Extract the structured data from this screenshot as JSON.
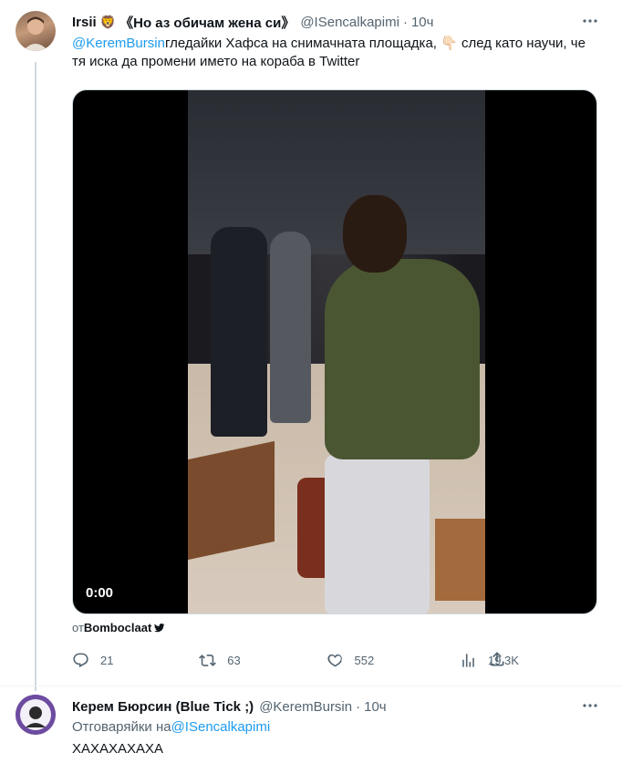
{
  "main_tweet": {
    "display_name": "Irsii",
    "name_suffix": "《Но аз обичам жена си》",
    "handle": "@ISencalkapimi",
    "time": "10ч",
    "mention": "@KeremBursin",
    "text_part1": "гледайки Хафса на снимачната площадка, ",
    "text_part2": " след като научи, че тя иска да промени името на кораба в Twitter",
    "emoji_lion": "🦁",
    "emoji_hand": "👇🏻",
    "video_time": "0:00",
    "attribution_prefix": "от",
    "attribution_source": "Bomboclaat",
    "stats": {
      "replies": "21",
      "retweets": "63",
      "likes": "552",
      "views": "19.3K"
    }
  },
  "reply_tweet": {
    "display_name": "Керем Бюрсин (Blue Tick ;)",
    "handle": "@KeremBursin",
    "time": "10ч",
    "replying_prefix": "Отговаряйки на",
    "replying_handle": "@ISencalkapimi",
    "text": "ХАХАХАХАХА"
  },
  "colors": {
    "accent": "#1d9bf0",
    "secondary_text": "#536471",
    "primary_text": "#0f1419",
    "border": "#cfd9de"
  },
  "icons": {
    "more": "more-dots-icon",
    "reply": "reply-icon",
    "retweet": "retweet-icon",
    "like": "heart-icon",
    "views": "views-chart-icon",
    "share": "share-icon",
    "source": "twitter-bird-icon"
  }
}
